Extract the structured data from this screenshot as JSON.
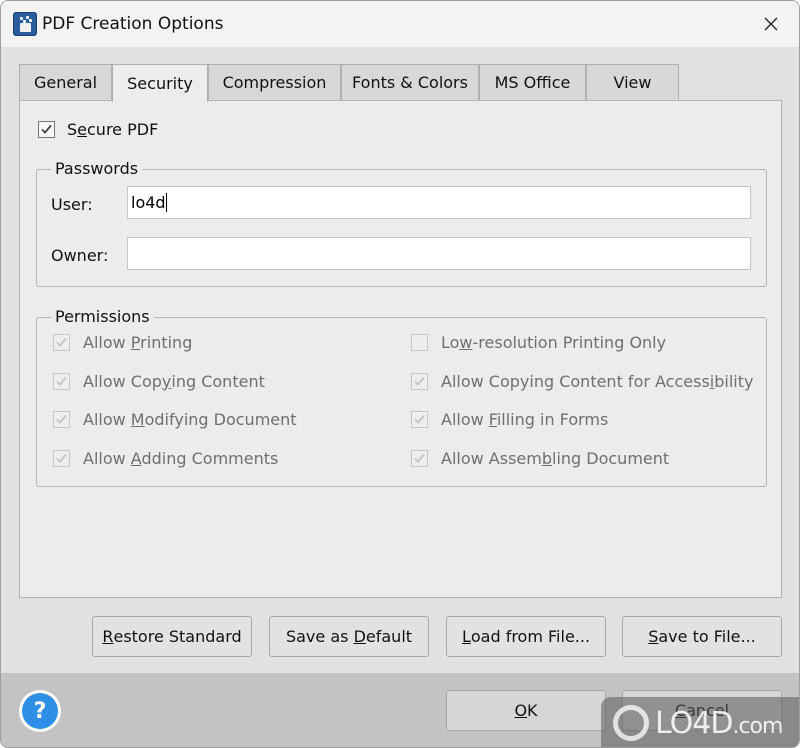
{
  "window": {
    "title": "PDF Creation Options",
    "icon": "pdf-creator-app-icon",
    "close_icon": "close-icon"
  },
  "tabs": [
    {
      "label": "General",
      "active": false
    },
    {
      "label": "Security",
      "active": true
    },
    {
      "label": "Compression",
      "active": false
    },
    {
      "label": "Fonts & Colors",
      "active": false
    },
    {
      "label": "MS Office",
      "active": false
    },
    {
      "label": "View",
      "active": false
    }
  ],
  "security": {
    "secure_pdf": {
      "pre": "S",
      "mn": "e",
      "post": "cure PDF",
      "checked": true
    },
    "passwords": {
      "legend": "Passwords",
      "user_label": "User:",
      "user_value": "lo4d",
      "owner_label": "Owner:",
      "owner_value": ""
    },
    "permissions": {
      "legend": "Permissions",
      "left": [
        {
          "pre": "Allow ",
          "mn": "P",
          "post": "rinting",
          "checked": true,
          "enabled": false
        },
        {
          "pre": "Allow Cop",
          "mn": "y",
          "post": "ing Content",
          "checked": true,
          "enabled": false
        },
        {
          "pre": "Allow ",
          "mn": "M",
          "post": "odifying Document",
          "checked": true,
          "enabled": false
        },
        {
          "pre": "Allow ",
          "mn": "A",
          "post": "dding Comments",
          "checked": true,
          "enabled": false
        }
      ],
      "right": [
        {
          "pre": "Lo",
          "mn": "w",
          "post": "-resolution Printing Only",
          "checked": false,
          "enabled": false
        },
        {
          "pre": "Allow Copying Content for Access",
          "mn": "i",
          "post": "bility",
          "checked": true,
          "enabled": false
        },
        {
          "pre": "Allow ",
          "mn": "F",
          "post": "illing in Forms",
          "checked": true,
          "enabled": false
        },
        {
          "pre": "Allow Assem",
          "mn": "b",
          "post": "ling Document",
          "checked": true,
          "enabled": false
        }
      ]
    }
  },
  "buttons": {
    "restore": {
      "pre": "",
      "mn": "R",
      "post": "estore Standard"
    },
    "save_default": {
      "pre": "Save as ",
      "mn": "D",
      "post": "efault"
    },
    "load_file": {
      "pre": "",
      "mn": "L",
      "post": "oad from File..."
    },
    "save_file": {
      "pre": "",
      "mn": "S",
      "post": "ave to File..."
    },
    "ok": {
      "pre": "",
      "mn": "O",
      "post": "K"
    },
    "cancel": {
      "pre": "",
      "mn": "C",
      "post": "ancel"
    }
  },
  "help": {
    "label": "?"
  },
  "watermark": {
    "text": "LO4D",
    "suffix": ".com"
  }
}
